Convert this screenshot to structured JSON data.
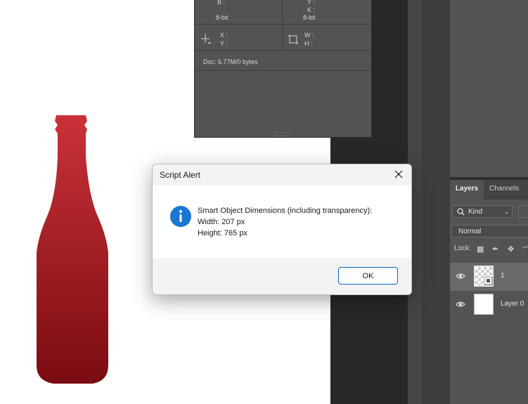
{
  "info_panel": {
    "b_label": "B :",
    "y_label": "Y :",
    "k_label": "K :",
    "bit_left": "8-bit",
    "bit_right": "8-bit",
    "x_label": "X :",
    "y2_label": "Y :",
    "w_label": "W :",
    "h_label": "H :",
    "doc_info": "Doc: 6.77M/0 bytes"
  },
  "layers_panel": {
    "tabs": [
      "Layers",
      "Channels"
    ],
    "kind_label": "Kind",
    "blend_mode": "Normal",
    "lock_label": "Lock:",
    "layers": [
      {
        "name": "1",
        "selected": true,
        "visible": true
      },
      {
        "name": "Layer 0",
        "selected": false,
        "visible": true
      }
    ]
  },
  "dialog": {
    "title": "Script Alert",
    "message_line1": "Smart Object Dimensions (including transparency):",
    "message_line2": "Width: 207 px",
    "message_line3": "Height: 765 px",
    "ok_label": "OK"
  },
  "colors": {
    "bottle_top": "#c93238",
    "bottle_bottom": "#7a0c12",
    "accent": "#0067c0",
    "info_blue": "#1976d2"
  }
}
